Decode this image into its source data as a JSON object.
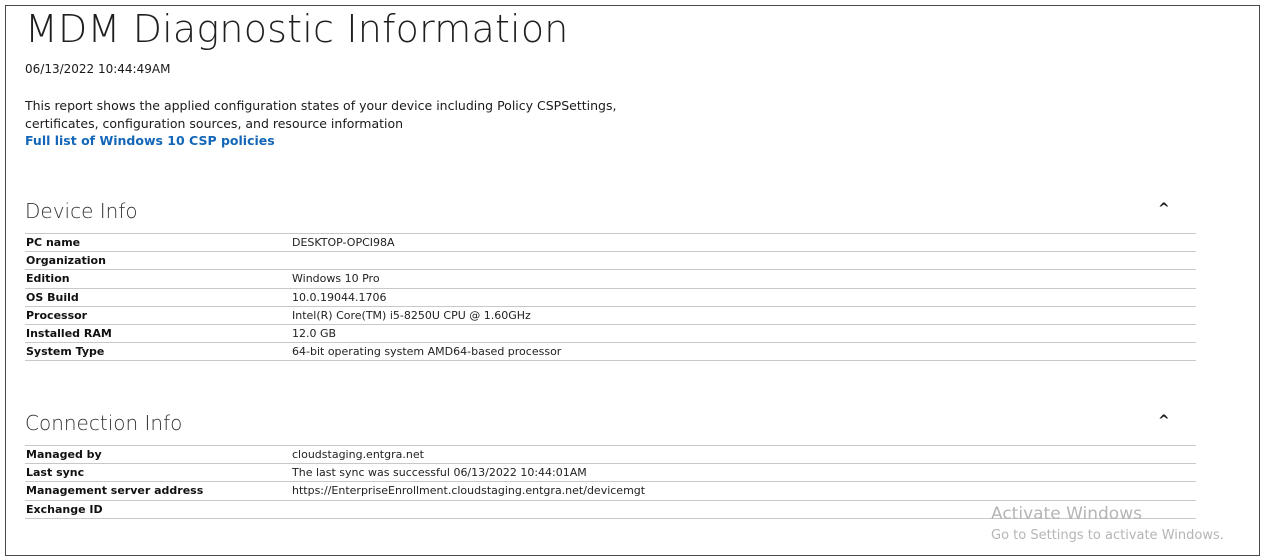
{
  "page": {
    "title": "MDM Diagnostic Information",
    "timestamp": "06/13/2022 10:44:49AM",
    "description_line1": "This report shows the applied configuration states of your device including Policy CSPSettings,",
    "description_line2": "certificates, configuration sources, and resource information",
    "csp_link_label": "Full list of Windows 10 CSP policies"
  },
  "device_info": {
    "title": "Device Info",
    "collapse_icon": "caret-up-icon",
    "rows": [
      {
        "label": "PC name",
        "value": "DESKTOP-OPCI98A"
      },
      {
        "label": "Organization",
        "value": ""
      },
      {
        "label": "Edition",
        "value": "Windows 10 Pro"
      },
      {
        "label": "OS Build",
        "value": "10.0.19044.1706"
      },
      {
        "label": "Processor",
        "value": "Intel(R) Core(TM) i5-8250U CPU @ 1.60GHz"
      },
      {
        "label": "Installed RAM",
        "value": "12.0 GB"
      },
      {
        "label": "System Type",
        "value": "64-bit operating system AMD64-based processor"
      }
    ]
  },
  "connection_info": {
    "title": "Connection Info",
    "collapse_icon": "caret-up-icon",
    "rows": [
      {
        "label": "Managed by",
        "value": "cloudstaging.entgra.net"
      },
      {
        "label": "Last sync",
        "value": "The last sync was successful 06/13/2022 10:44:01AM"
      },
      {
        "label": "Management server address",
        "value": "https://EnterpriseEnrollment.cloudstaging.entgra.net/devicemgt"
      },
      {
        "label": "Exchange ID",
        "value": ""
      }
    ]
  },
  "watermark": {
    "line1": "Activate Windows",
    "line2": "Go to Settings to activate Windows."
  },
  "colors": {
    "link": "#1467b8",
    "divider": "#c8c8c8",
    "watermark": "#b5b5b5"
  }
}
